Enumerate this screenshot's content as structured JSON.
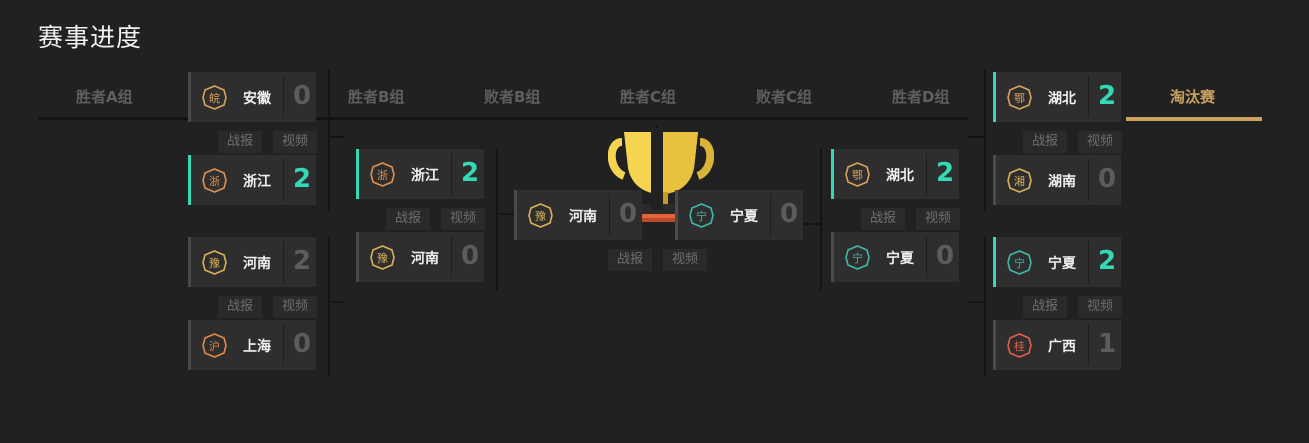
{
  "page_title": "赛事进度",
  "tabs": [
    {
      "label": "胜者A组"
    },
    {
      "label": "胜者B组"
    },
    {
      "label": "败者B组"
    },
    {
      "label": "胜者C组"
    },
    {
      "label": "败者C组"
    },
    {
      "label": "胜者D组"
    },
    {
      "label": "淘汰赛"
    }
  ],
  "active_tab": "淘汰赛",
  "colors": {
    "accent": "#c8a25d",
    "winner": "#35d9b5",
    "background": "#212121",
    "card": "#2e2e2e"
  },
  "match_links": {
    "report": "战报",
    "video": "视频"
  },
  "matches": [
    {
      "teams": [
        {
          "name": "安徽",
          "emblem": "皖",
          "score": "0"
        },
        {
          "name": "浙江",
          "emblem": "浙",
          "score": "2"
        }
      ]
    },
    {
      "teams": [
        {
          "name": "河南",
          "emblem": "豫",
          "score": "2"
        },
        {
          "name": "上海",
          "emblem": "沪",
          "score": "0"
        }
      ]
    },
    {
      "teams": [
        {
          "name": "浙江",
          "emblem": "浙",
          "score": "2"
        },
        {
          "name": "河南",
          "emblem": "豫",
          "score": "0"
        }
      ]
    },
    {
      "teams": [
        {
          "name": "河南",
          "emblem": "豫",
          "score": "0"
        },
        {
          "name": "宁夏",
          "emblem": "宁",
          "score": "0"
        }
      ]
    },
    {
      "teams": [
        {
          "name": "湖北",
          "emblem": "鄂",
          "score": "2"
        },
        {
          "name": "宁夏",
          "emblem": "宁",
          "score": "0"
        }
      ]
    },
    {
      "teams": [
        {
          "name": "湖北",
          "emblem": "鄂",
          "score": "2"
        },
        {
          "name": "湖南",
          "emblem": "湘",
          "score": "0"
        }
      ]
    },
    {
      "teams": [
        {
          "name": "宁夏",
          "emblem": "宁",
          "score": "2"
        },
        {
          "name": "广西",
          "emblem": "桂",
          "score": "1"
        }
      ]
    }
  ]
}
